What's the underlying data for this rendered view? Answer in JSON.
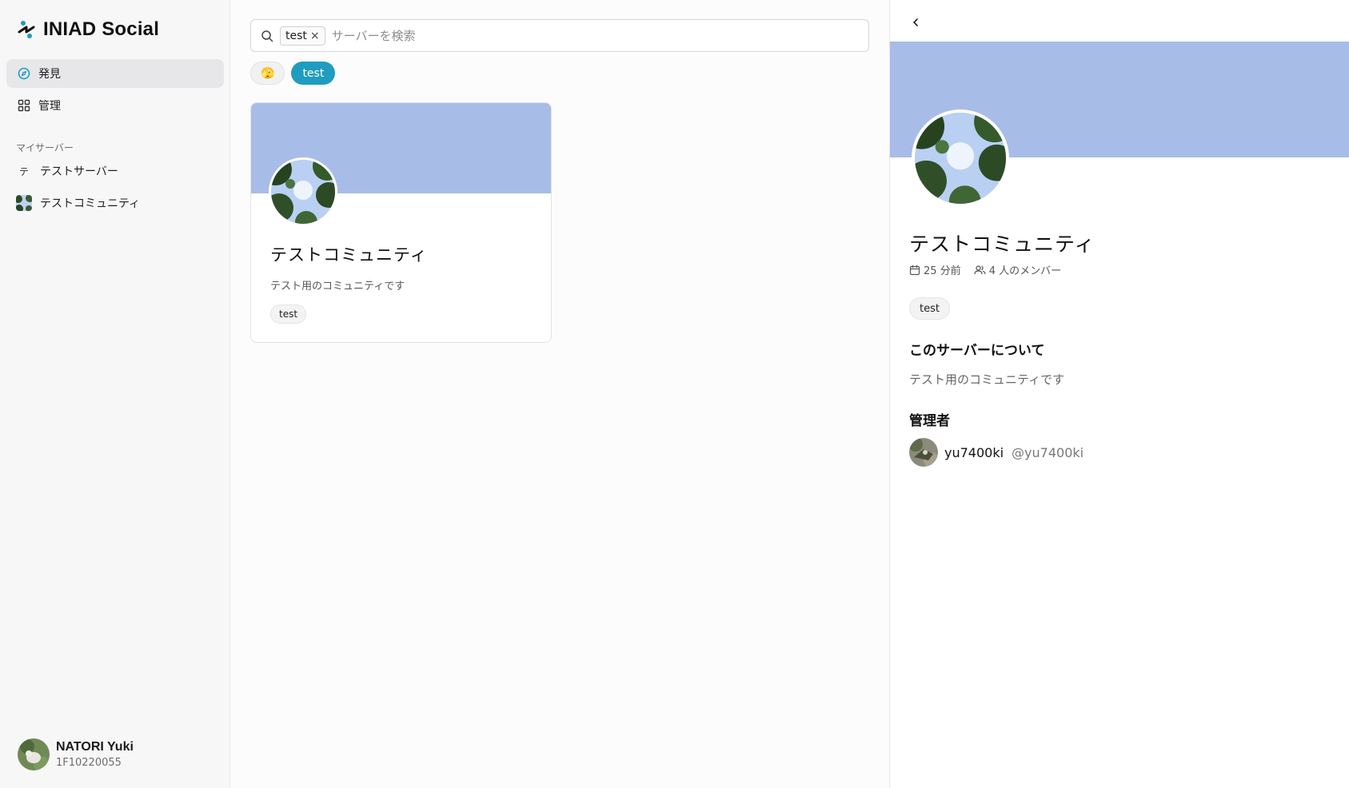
{
  "app": {
    "brand_name": "INIAD Social",
    "brand_color": "#1f9cc0"
  },
  "sidebar": {
    "nav": [
      {
        "label": "発見",
        "icon": "compass-icon",
        "active": true
      },
      {
        "label": "管理",
        "icon": "grid-icon",
        "active": false
      }
    ],
    "section_label": "マイサーバー",
    "servers": [
      {
        "initial": "テ",
        "label": "テストサーバー"
      },
      {
        "label": "テストコミュニティ",
        "icon": "server-thumbnail"
      }
    ],
    "user": {
      "name": "NATORI Yuki",
      "id": "1F10220055"
    }
  },
  "search": {
    "chip": "test",
    "placeholder": "サーバーを検索",
    "value": ""
  },
  "tags": {
    "emoji": "🫣",
    "active": "test"
  },
  "results": [
    {
      "title": "テストコミュニティ",
      "description": "テスト用のコミュニティです",
      "tag": "test"
    }
  ],
  "detail": {
    "title": "テストコミュニティ",
    "created": "25 分前",
    "members": "4 人のメンバー",
    "tag": "test",
    "about_heading": "このサーバーについて",
    "about_text": "テスト用のコミュニティです",
    "admin_heading": "管理者",
    "admin_name": "yu7400ki",
    "admin_handle": "@yu7400ki"
  },
  "colors": {
    "banner": "#a8bce8",
    "active_tag": "#1f9cc0"
  }
}
